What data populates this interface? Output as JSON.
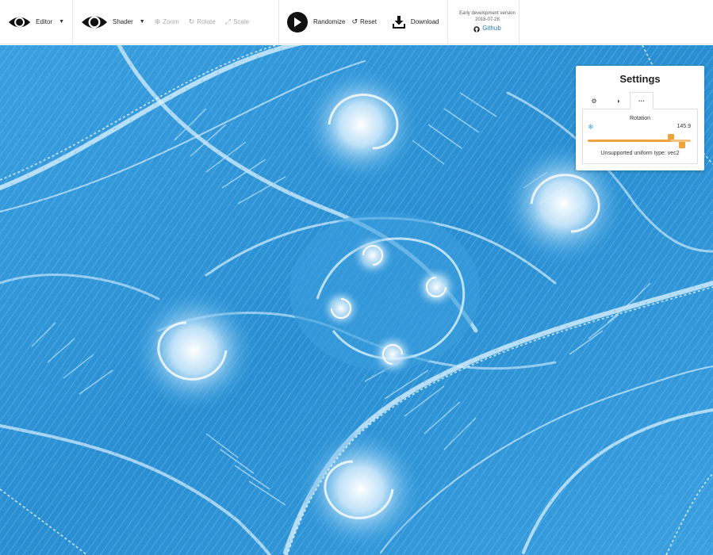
{
  "toolbar": {
    "editor_label": "Editor",
    "shader_label": "Shader",
    "zoom_label": "Zoom",
    "rotate_label": "Rotate",
    "scale_label": "Scale",
    "randomize_label": "Randomize",
    "reset_label": "Reset",
    "download_label": "Download"
  },
  "info": {
    "version_text": "Early development version",
    "date_text": "2018-07-28",
    "github_label": "Github"
  },
  "settings": {
    "title": "Settings",
    "tabs": [
      {
        "icon": "gears-icon",
        "glyph": "⚙"
      },
      {
        "icon": "contrast-icon",
        "glyph": "◑"
      },
      {
        "icon": "ellipsis-icon",
        "glyph": "···"
      }
    ],
    "active_tab": 2,
    "rotation": {
      "label": "Rotation",
      "value": "145.9",
      "fraction": 0.81
    },
    "unsupported_text": "Unsupported uniform type: vec2"
  },
  "colors": {
    "accent": "#f0a23c",
    "link": "#2a79c4",
    "fractal_base": "#2d93d6",
    "fractal_light": "#e8f6ff"
  }
}
